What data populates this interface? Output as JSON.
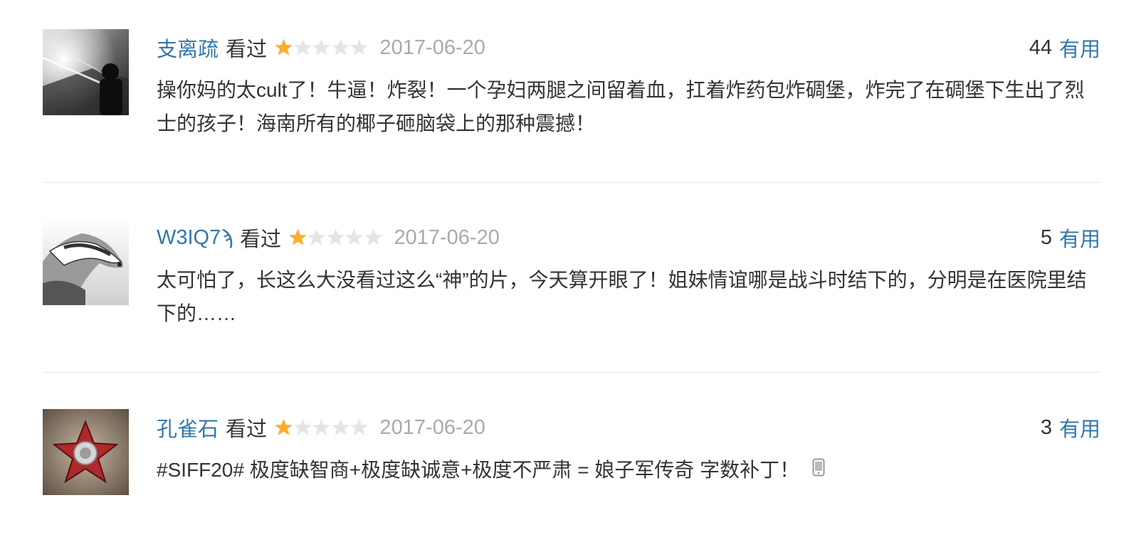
{
  "comments": [
    {
      "user": "支离疏",
      "status": "看过",
      "rating": 1,
      "rating_max": 5,
      "date": "2017-06-20",
      "votes": "44",
      "useful_label": "有用",
      "avatar_icon": "avatar-night-street-photo",
      "text": "操你妈的太cult了！牛逼！炸裂！一个孕妇两腿之间留着血，扛着炸药包炸碉堡，炸完了在碉堡下生出了烈士的孩子！海南所有的椰子砸脑袋上的那种震撼！"
    },
    {
      "user": "W3IQ7ϡ",
      "status": "看过",
      "rating": 1,
      "rating_max": 5,
      "date": "2017-06-20",
      "votes": "5",
      "useful_label": "有用",
      "avatar_icon": "avatar-badger-drawing",
      "text": "太可怕了，长这么大没看过这么“神”的片，今天算开眼了！姐妹情谊哪是战斗时结下的，分明是在医院里结下的……"
    },
    {
      "user": "孔雀石",
      "status": "看过",
      "rating": 1,
      "rating_max": 5,
      "date": "2017-06-20",
      "votes": "3",
      "useful_label": "有用",
      "avatar_icon": "avatar-red-star-badge",
      "text": "#SIFF20# 极度缺智商+极度缺诚意+极度不严肃 = 娘子军传奇 字数补丁！",
      "extra_icon": "mobile-phone-icon"
    }
  ],
  "colors": {
    "link": "#3377aa",
    "text": "#333333",
    "date": "#aaaaaa",
    "star_on": "#ffac2d",
    "star_off": "#e5e5e5",
    "divider": "#e5e5e5"
  }
}
